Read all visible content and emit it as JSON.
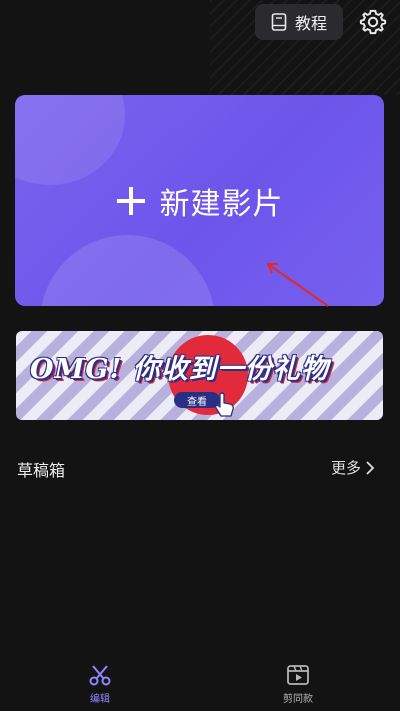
{
  "header": {
    "tutorial_label": "教程"
  },
  "new_project": {
    "label": "新建影片"
  },
  "banner": {
    "headline": "OMG! 你收到一份礼物",
    "button_label": "查看"
  },
  "drafts": {
    "title": "草稿箱",
    "more_label": "更多"
  },
  "bottom_nav": {
    "items": [
      {
        "label": "编辑",
        "icon": "scissors-icon",
        "active": true
      },
      {
        "label": "剪同款",
        "icon": "clapperboard-icon",
        "active": false
      }
    ]
  },
  "colors": {
    "accent": "#8f85ff",
    "card": "#7160ec",
    "background": "#131313",
    "banner_red": "#e22a3d"
  }
}
